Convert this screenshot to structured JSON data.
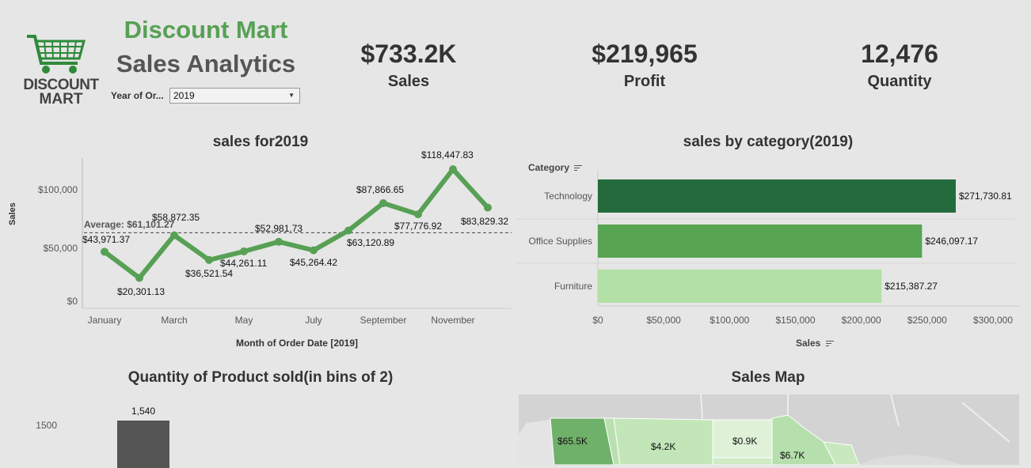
{
  "header": {
    "brand_title": "Discount Mart",
    "subtitle": "Sales Analytics",
    "logo_text_line1": "DISCOUNT",
    "logo_text_line2": "MART",
    "filter_label": "Year of Or...",
    "filter_value": "2019"
  },
  "kpis": [
    {
      "value": "$733.2K",
      "label": "Sales"
    },
    {
      "value": "$219,965",
      "label": "Profit"
    },
    {
      "value": "12,476",
      "label": "Quantity"
    }
  ],
  "line_chart": {
    "title": "sales for2019",
    "xlabel": "Month of Order Date [2019]",
    "ylabel": "Sales",
    "y_ticks": [
      "$100,000",
      "$50,000",
      "$0"
    ],
    "x_ticks": [
      "January",
      "March",
      "May",
      "July",
      "September",
      "November"
    ],
    "average_label": "Average: $61,101.27"
  },
  "bar_chart": {
    "title": "sales by category(2019)",
    "category_header": "Category",
    "xlabel": "Sales",
    "x_ticks": [
      "$0",
      "$50,000",
      "$100,000",
      "$150,000",
      "$200,000",
      "$250,000",
      "$300,000"
    ]
  },
  "histogram": {
    "title": "Quantity of Product sold(in bins of 2)",
    "y_tick": "1500",
    "bar_label": "1,540"
  },
  "map": {
    "title": "Sales Map",
    "labels": [
      "$65.5K",
      "$4.2K",
      "$0.9K",
      "$6.7K"
    ]
  },
  "colors": {
    "brand_green": "#57a055",
    "line_green": "#57a055",
    "tech_bar": "#236b3c",
    "office_bar": "#57a452",
    "furniture_bar": "#b3e0a6",
    "hist_bar": "#555555"
  },
  "chart_data": [
    {
      "type": "line",
      "title": "sales for2019",
      "xlabel": "Month of Order Date [2019]",
      "ylabel": "Sales",
      "ylim": [
        0,
        130000
      ],
      "x": [
        "January",
        "February",
        "March",
        "April",
        "May",
        "June",
        "July",
        "August",
        "September",
        "October",
        "November",
        "December"
      ],
      "series": [
        {
          "values": [
            43971.37,
            20301.13,
            58872.35,
            36521.54,
            44261.11,
            52981.73,
            45264.42,
            63120.89,
            87866.65,
            77776.92,
            118447.83,
            83829.32
          ]
        }
      ],
      "data_labels": [
        "$43,971.37",
        "$20,301.13",
        "$58,872.35",
        "$36,521.54",
        "$44,261.11",
        "$52,981.73",
        "$45,264.42",
        "$63,120.89",
        "$87,866.65",
        "$77,776.92",
        "$118,447.83",
        "$83,829.32"
      ],
      "average": 61101.27
    },
    {
      "type": "bar",
      "title": "sales by category(2019)",
      "xlabel": "Sales",
      "categories": [
        "Technology",
        "Office Supplies",
        "Furniture"
      ],
      "values": [
        271730.81,
        246097.17,
        215387.27
      ],
      "data_labels": [
        "$271,730.81",
        "$246,097.17",
        "$215,387.27"
      ],
      "xlim": [
        0,
        300000
      ]
    },
    {
      "type": "bar",
      "title": "Quantity of Product sold(in bins of 2)",
      "values": [
        1540
      ],
      "data_labels": [
        "1,540"
      ]
    }
  ]
}
